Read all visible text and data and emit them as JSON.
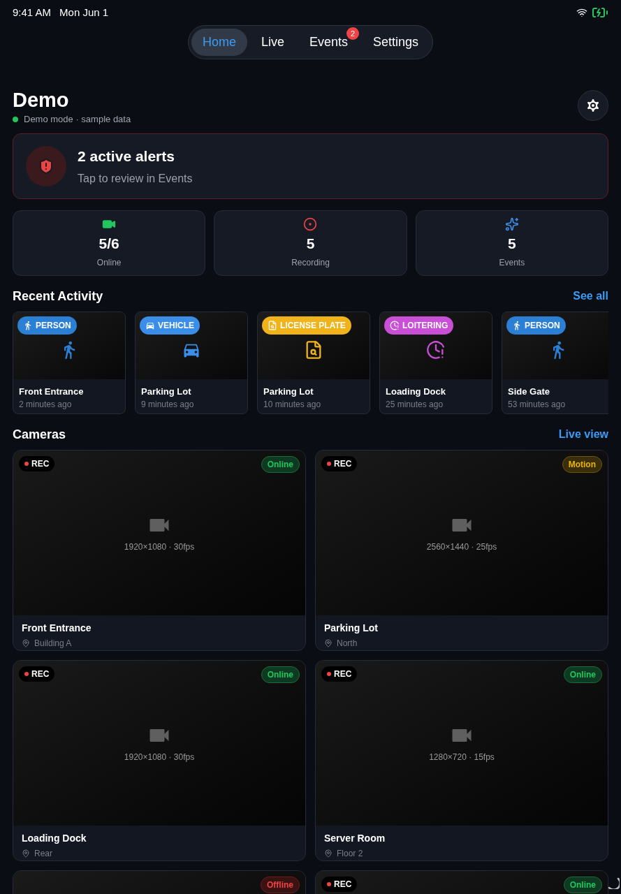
{
  "status_bar": {
    "time": "9:41 AM",
    "date": "Mon Jun 1"
  },
  "tabs": [
    {
      "label": "Home",
      "selected": true
    },
    {
      "label": "Live",
      "selected": false
    },
    {
      "label": "Events",
      "selected": false,
      "badge": "2"
    },
    {
      "label": "Settings",
      "selected": false
    }
  ],
  "header": {
    "title": "Demo",
    "subtitle": "Demo mode · sample data",
    "color": "#22c55e"
  },
  "alert": {
    "title": "2 active alerts",
    "subtitle": "Tap to review in Events"
  },
  "stats": [
    {
      "kind": "camera",
      "value": "5/6",
      "label": "Online"
    },
    {
      "kind": "recording",
      "value": "5",
      "label": "Recording"
    },
    {
      "kind": "events",
      "value": "5",
      "label": "Events"
    }
  ],
  "recent_activity": {
    "title": "Recent Activity",
    "link": "See all",
    "items": [
      {
        "kind": "person",
        "tag": "PERSON",
        "color": "#2b7fd4",
        "camera": "Front Entrance",
        "time": "2 minutes ago"
      },
      {
        "kind": "vehicle",
        "tag": "VEHICLE",
        "color": "#3b8ee8",
        "camera": "Parking Lot",
        "time": "9 minutes ago"
      },
      {
        "kind": "plate",
        "tag": "LICENSE PLATE",
        "color": "#f0b41a",
        "camera": "Parking Lot",
        "time": "10 minutes ago"
      },
      {
        "kind": "loitering",
        "tag": "LOITERING",
        "color": "#c94fd6",
        "camera": "Loading Dock",
        "time": "25 minutes ago"
      },
      {
        "kind": "person",
        "tag": "PERSON",
        "color": "#2b7fd4",
        "camera": "Side Gate",
        "time": "53 minutes ago"
      }
    ]
  },
  "cameras": {
    "title": "Cameras",
    "link": "Live view",
    "items": [
      {
        "rec": true,
        "rec_label": "REC",
        "kind": "online",
        "status_label": "Online",
        "resolution": "1920×1080 · 30fps",
        "name": "Front Entrance",
        "location": "Building A"
      },
      {
        "rec": true,
        "rec_label": "REC",
        "kind": "motion",
        "status_label": "Motion",
        "resolution": "2560×1440 · 25fps",
        "name": "Parking Lot",
        "location": "North"
      },
      {
        "rec": true,
        "rec_label": "REC",
        "kind": "online",
        "status_label": "Online",
        "resolution": "1920×1080 · 30fps",
        "name": "Loading Dock",
        "location": "Rear"
      },
      {
        "rec": true,
        "rec_label": "REC",
        "kind": "online",
        "status_label": "Online",
        "resolution": "1280×720 · 15fps",
        "name": "Server Room",
        "location": "Floor 2"
      },
      {
        "rec": false,
        "kind": "offline",
        "status_label": "Offline"
      },
      {
        "rec": true,
        "rec_label": "REC",
        "kind": "online",
        "status_label": "Online"
      }
    ]
  }
}
